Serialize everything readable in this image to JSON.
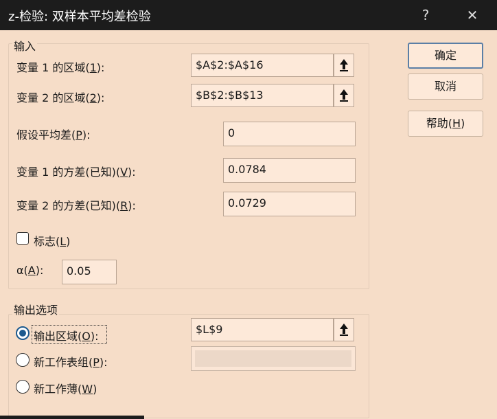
{
  "window": {
    "title": "z-检验: 双样本平均差检验",
    "help_glyph": "?",
    "close_glyph": "✕"
  },
  "input_group": {
    "label": "输入",
    "var1_range": {
      "label_pre": "变量 1 的区域(",
      "key": "1",
      "label_post": "):",
      "value": "$A$2:$A$16"
    },
    "var2_range": {
      "label_pre": "变量 2 的区域(",
      "key": "2",
      "label_post": "):",
      "value": "$B$2:$B$13"
    },
    "mean_diff": {
      "label_pre": "假设平均差(",
      "key": "P",
      "label_post": "):",
      "value": "0"
    },
    "var1_variance": {
      "label_pre": "变量 1 的方差(已知)(",
      "key": "V",
      "label_post": "):",
      "value": "0.0784"
    },
    "var2_variance": {
      "label_pre": "变量 2 的方差(已知)(",
      "key": "R",
      "label_post": "):",
      "value": "0.0729"
    },
    "labels_checkbox": {
      "label_pre": "标志(",
      "key": "L",
      "label_post": ")",
      "checked": false
    },
    "alpha": {
      "label_pre": "α(",
      "key": "A",
      "label_post": "):",
      "value": "0.05"
    }
  },
  "output_group": {
    "label": "输出选项",
    "output_range": {
      "label_pre": "输出区域(",
      "key": "O",
      "label_post": "):",
      "value": "$L$9",
      "selected": true
    },
    "new_sheet": {
      "label_pre": "新工作表组(",
      "key": "P",
      "label_post": "):",
      "value": "",
      "selected": false
    },
    "new_workbook": {
      "label_pre": "新工作薄(",
      "key": "W",
      "label_post": ")",
      "selected": false
    }
  },
  "buttons": {
    "ok": "确定",
    "cancel": "取消",
    "help": {
      "label_pre": "帮助(",
      "key": "H",
      "label_post": ")"
    }
  },
  "icons": {
    "range_select": "collapse-dialog-arrow-icon"
  },
  "colors": {
    "dialog_bg": "#f6ddc8",
    "field_bg": "#fde9d9",
    "titlebar_bg": "#1c1c1c",
    "accent": "#1d5a8e"
  }
}
